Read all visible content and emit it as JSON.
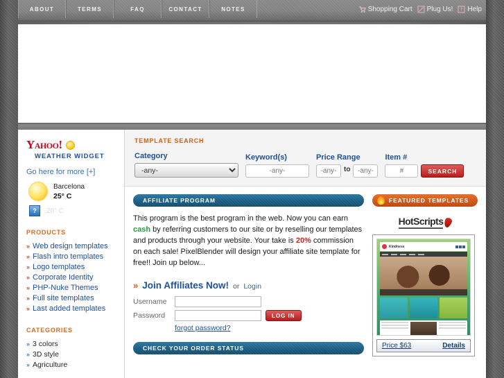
{
  "topnav": {
    "tabs": [
      {
        "label": "ABOUT",
        "name": "about"
      },
      {
        "label": "TERMS",
        "name": "terms"
      },
      {
        "label": "FAQ",
        "name": "faq"
      },
      {
        "label": "CONTACT",
        "name": "contact"
      },
      {
        "label": "NOTES",
        "name": "notes"
      }
    ],
    "utility": [
      {
        "label": "Shopping Cart",
        "icon": "cart-icon"
      },
      {
        "label": "Plug Us!",
        "icon": "link-icon"
      },
      {
        "label": "Help",
        "icon": "help-icon"
      }
    ]
  },
  "sidebar": {
    "widget": {
      "brand": "Yahoo!",
      "subtitle": "WEATHER WIDGET",
      "more_link": "Go here for more [+]",
      "city": "Barcelona",
      "temperature": "25° C",
      "secondary_temp": "20° C"
    },
    "products_heading": "PRODUCTS",
    "products": [
      {
        "label": "Web design templates"
      },
      {
        "label": "Flash intro templates"
      },
      {
        "label": "Logo templates"
      },
      {
        "label": "Corporate Identity"
      },
      {
        "label": "PHP-Nuke Themes"
      },
      {
        "label": "Full site templates"
      },
      {
        "label": "Last added templates"
      }
    ],
    "categories_heading": "CATEGORIES",
    "categories": [
      {
        "label": "3 colors"
      },
      {
        "label": "3D style"
      },
      {
        "label": "Agriculture"
      }
    ]
  },
  "search": {
    "title": "TEMPLATE SEARCH",
    "category_label": "Category",
    "category_value": "-any-",
    "category_options": [
      "-any-"
    ],
    "keyword_label": "Keyword(s)",
    "keyword_placeholder": "-any-",
    "keyword_value": "",
    "price_label": "Price Range",
    "price_min_placeholder": "-any-",
    "price_max_placeholder": "-any-",
    "price_to": "to",
    "item_label": "Item #",
    "item_placeholder": "#",
    "search_button": "SEARCH"
  },
  "affiliate": {
    "bar_title": "AFFILIATE PROGRAM",
    "paragraph_1": "This program is the best program in the web. Now you can earn ",
    "highlight_cash": "cash",
    "paragraph_2": " by referring customers to our site or by reselling our templates and products through your website. Your take is ",
    "highlight_pct": "20%",
    "paragraph_3": " commission on each sale! PixelBlender will design your affiliate site template for free!! Join up below...",
    "join_link": "Join Affiliates Now!",
    "or_word": "or",
    "login_link": "Login",
    "username_label": "Username",
    "username_value": "",
    "password_label": "Password",
    "password_value": "",
    "login_button": "LOG IN",
    "forgot_link": "forgot password?",
    "order_bar_title": "CHECK YOUR ORDER STATUS"
  },
  "featured": {
    "bar_title": "FEATURED TEMPLATES",
    "sponsor_logo": "HotScripts",
    "template": {
      "brand": "Kindness",
      "price": "Price $63",
      "details": "Details"
    }
  }
}
